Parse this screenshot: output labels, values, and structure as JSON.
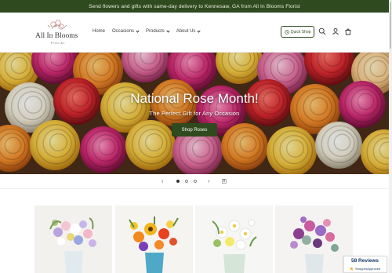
{
  "announcement": {
    "text": "Send flowers and gifts with same-day delivery to Kennesaw, GA from All In Blooms Florist"
  },
  "logo": {
    "name": "All In Blooms",
    "tagline": "Florist"
  },
  "nav": {
    "items": [
      {
        "label": "Home",
        "dropdown": false
      },
      {
        "label": "Occasions",
        "dropdown": true
      },
      {
        "label": "Products",
        "dropdown": true
      },
      {
        "label": "About Us",
        "dropdown": true
      }
    ]
  },
  "header_actions": {
    "quick_shop_label": "Quick Shop",
    "icons": [
      "search-icon",
      "account-icon",
      "cart-icon"
    ]
  },
  "hero": {
    "title": "National Rose Month!",
    "subtitle": "The Perfect Gift for Any Occasion",
    "button_label": "Shop Roses"
  },
  "slider": {
    "slide_count": 3,
    "active_slide": 1,
    "prev_icon": "chevron-left-icon",
    "next_icon": "chevron-right-icon",
    "pause_icon": "pause-icon"
  },
  "products": [
    {
      "image": "pastel-wildflower-bouquet"
    },
    {
      "image": "orange-sunflower-bouquet"
    },
    {
      "image": "white-daisy-bouquet"
    },
    {
      "image": "purple-rose-succulent-bouquet"
    }
  ],
  "reviews_badge": {
    "count_label": "58 Reviews",
    "provider": "ShopperApproved"
  },
  "colors": {
    "brand_green": "#2f4a1e",
    "text": "#3d3d3d",
    "background": "#ffffff"
  }
}
